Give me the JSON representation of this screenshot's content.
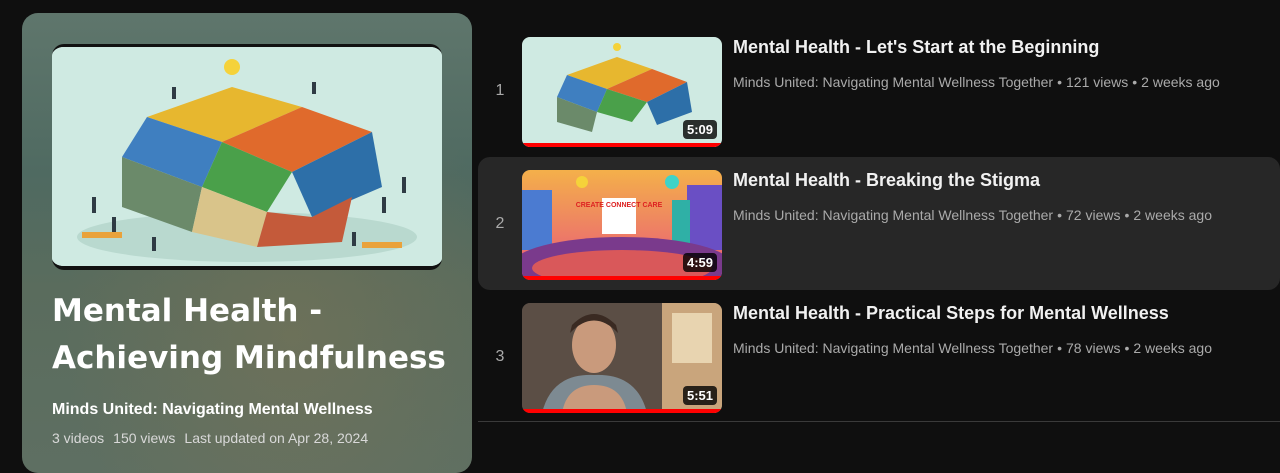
{
  "playlist": {
    "title": "Mental Health - Achieving Mindfulness",
    "owner": "Minds United: Navigating Mental Wellness",
    "video_count": "3 videos",
    "views": "150 views",
    "updated": "Last updated on Apr 28, 2024"
  },
  "videos": [
    {
      "index": "1",
      "title": "Mental Health - Let's Start at the Beginning",
      "channel": "Minds United: Navigating Mental Wellness Together",
      "views": "121 views",
      "age": "2 weeks ago",
      "duration": "5:09",
      "watched_fraction": 1.0
    },
    {
      "index": "2",
      "title": "Mental Health - Breaking the Stigma",
      "channel": "Minds United: Navigating Mental Wellness Together",
      "views": "72 views",
      "age": "2 weeks ago",
      "duration": "4:59",
      "watched_fraction": 1.0,
      "thumbnail_text": "CREATE CONNECT CARE"
    },
    {
      "index": "3",
      "title": "Mental Health - Practical Steps for Mental Wellness",
      "channel": "Minds United: Navigating Mental Wellness Together",
      "views": "78 views",
      "age": "2 weeks ago",
      "duration": "5:51",
      "watched_fraction": 1.0
    }
  ],
  "separators": {
    "dot": "•"
  },
  "colors": {
    "background": "#0f0f0f",
    "hover_row": "#272727",
    "progress": "#ff0000",
    "meta_text": "#aaaaaa"
  }
}
